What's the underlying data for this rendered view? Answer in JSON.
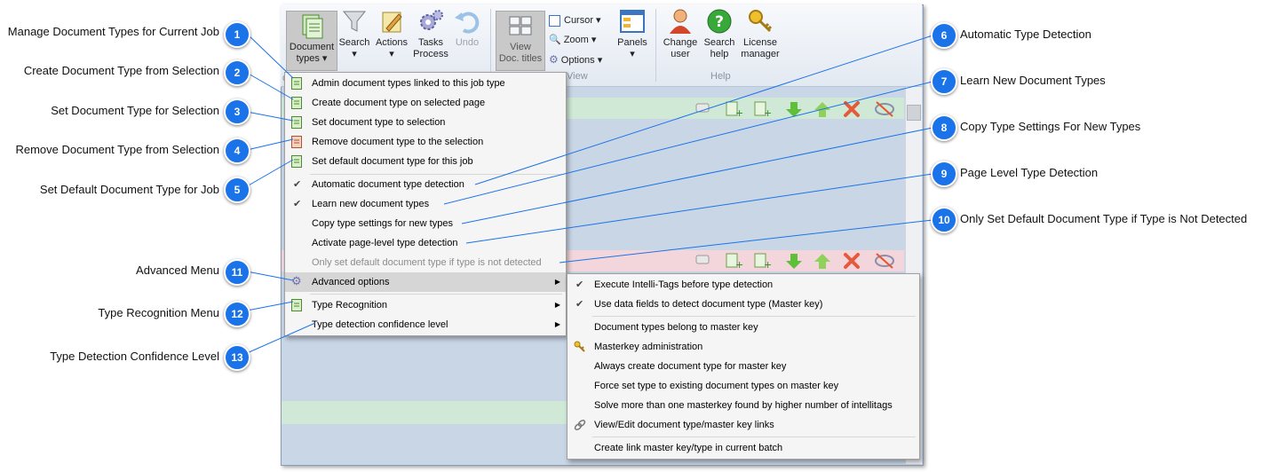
{
  "ribbon": {
    "buttons": [
      {
        "label1": "Document",
        "label2": "types ▾"
      },
      {
        "label1": "Search",
        "label2": "▾"
      },
      {
        "label1": "Actions",
        "label2": "▾"
      },
      {
        "label1": "Tasks",
        "label2": "Process"
      },
      {
        "label1": "Undo",
        "label2": ""
      },
      {
        "label1": "View",
        "label2": "Doc. titles"
      },
      {
        "label1": "Panels",
        "label2": "▾"
      },
      {
        "label1": "Change",
        "label2": "user"
      },
      {
        "label1": "Search",
        "label2": "help"
      },
      {
        "label1": "License",
        "label2": "manager"
      }
    ],
    "small": {
      "cursor": "Cursor ▾",
      "zoom": "Zoom ▾",
      "options": "Options ▾"
    },
    "groups": {
      "view": "View",
      "help": "Help"
    },
    "clipped": "o"
  },
  "menu": {
    "items": [
      {
        "label": "Admin document types linked to this job type"
      },
      {
        "label": "Create document type on selected page"
      },
      {
        "label": "Set document type to selection"
      },
      {
        "label": "Remove document type to the selection"
      },
      {
        "label": "Set default document type for this job"
      },
      {
        "label": "Automatic document type detection",
        "check": "✔"
      },
      {
        "label": "Learn new document types",
        "check": "✔"
      },
      {
        "label": "Copy type settings for new types"
      },
      {
        "label": "Activate page-level type detection"
      },
      {
        "label": "Only set default document type if type is not detected"
      },
      {
        "label": "Advanced options",
        "arrow": "▶"
      },
      {
        "label": "Type Recognition",
        "arrow": "▶"
      },
      {
        "label": "Type detection confidence level",
        "arrow": "▶"
      }
    ]
  },
  "submenu": {
    "items": [
      {
        "label": "Execute Intelli-Tags before type detection",
        "check": "✔"
      },
      {
        "label": "Use data fields to detect document type (Master key)",
        "check": "✔"
      },
      {
        "label": "Document types belong to master key"
      },
      {
        "label": "Masterkey administration"
      },
      {
        "label": "Always create document type for master key"
      },
      {
        "label": "Force set type to existing document types on master key"
      },
      {
        "label": "Solve more than one masterkey found by higher number of intellitags"
      },
      {
        "label": "View/Edit document type/master key links"
      },
      {
        "label": "Create link master key/type in current batch"
      }
    ]
  },
  "callouts": [
    {
      "n": "1",
      "text": "Manage Document Types for Current Job"
    },
    {
      "n": "2",
      "text": "Create Document Type from Selection"
    },
    {
      "n": "3",
      "text": "Set Document Type for Selection"
    },
    {
      "n": "4",
      "text": "Remove Document Type from Selection"
    },
    {
      "n": "5",
      "text": "Set Default Document Type for Job"
    },
    {
      "n": "6",
      "text": "Automatic Type Detection"
    },
    {
      "n": "7",
      "text": "Learn New Document Types"
    },
    {
      "n": "8",
      "text": "Copy Type Settings For New Types"
    },
    {
      "n": "9",
      "text": "Page Level Type Detection"
    },
    {
      "n": "10",
      "text": "Only Set Default Document Type if Type is Not Detected"
    },
    {
      "n": "11",
      "text": "Advanced Menu"
    },
    {
      "n": "12",
      "text": "Type Recognition Menu"
    },
    {
      "n": "13",
      "text": "Type Detection Confidence Level"
    }
  ],
  "colors": {
    "badge": "#1a73e8",
    "line": "#1a73e8",
    "green_row": "#cfe9d6",
    "pink_row": "#f2d6db",
    "content": "#c9d6e6"
  }
}
